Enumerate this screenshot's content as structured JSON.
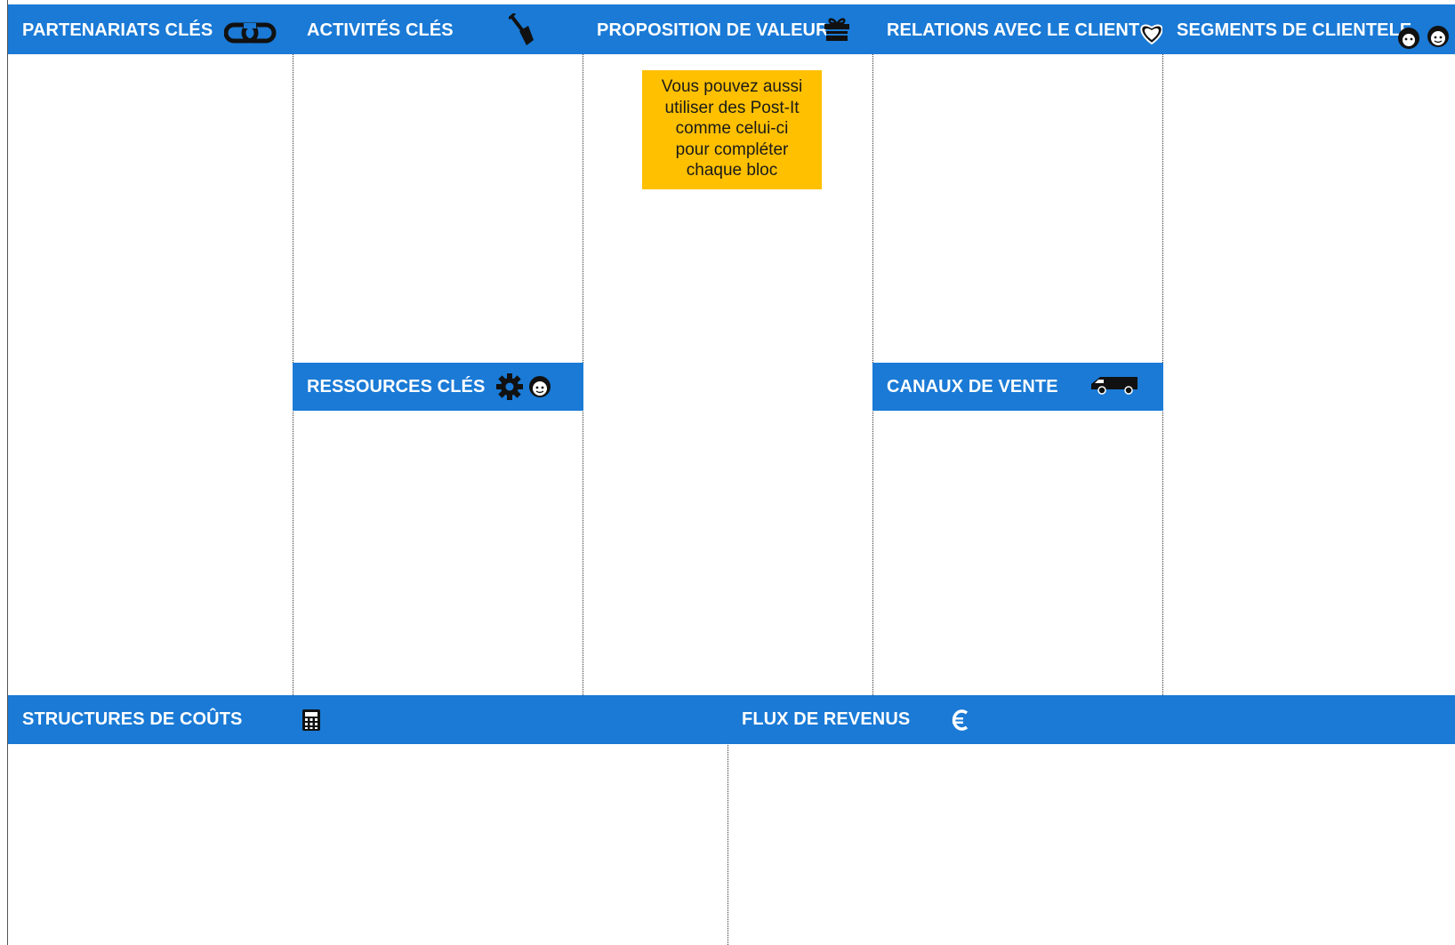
{
  "canvas": {
    "blocks": {
      "key_partners": {
        "title": "PARTENARIATS CLÉS",
        "icon": "link-icon"
      },
      "key_activities": {
        "title": "ACTIVITÉS CLÉS",
        "icon": "shovel-icon"
      },
      "value_proposition": {
        "title": "PROPOSITION DE VALEUR",
        "icon": "gift-icon"
      },
      "customer_relationships": {
        "title": "RELATIONS AVEC LE CLIENT",
        "icon": "heart-icon"
      },
      "customer_segments": {
        "title": "SEGMENTS  DE CLIENTELE",
        "icon": "people-icon"
      },
      "key_resources": {
        "title": "RESSOURCES CLÉS",
        "icon": "gear-person-icon"
      },
      "channels": {
        "title": "CANAUX DE VENTE",
        "icon": "van-icon"
      },
      "cost_structure": {
        "title": "STRUCTURES DE COÛTS",
        "icon": "calculator-icon"
      },
      "revenue_streams": {
        "title": "FLUX DE REVENUS",
        "icon": "euro-icon"
      }
    },
    "postit": {
      "text": "Vous pouvez aussi\nutiliser des Post-It\ncomme celui-ci\npour compléter\nchaque bloc"
    }
  },
  "colors": {
    "header_blue": "#1a7ad6",
    "postit_yellow": "#ffc000"
  }
}
